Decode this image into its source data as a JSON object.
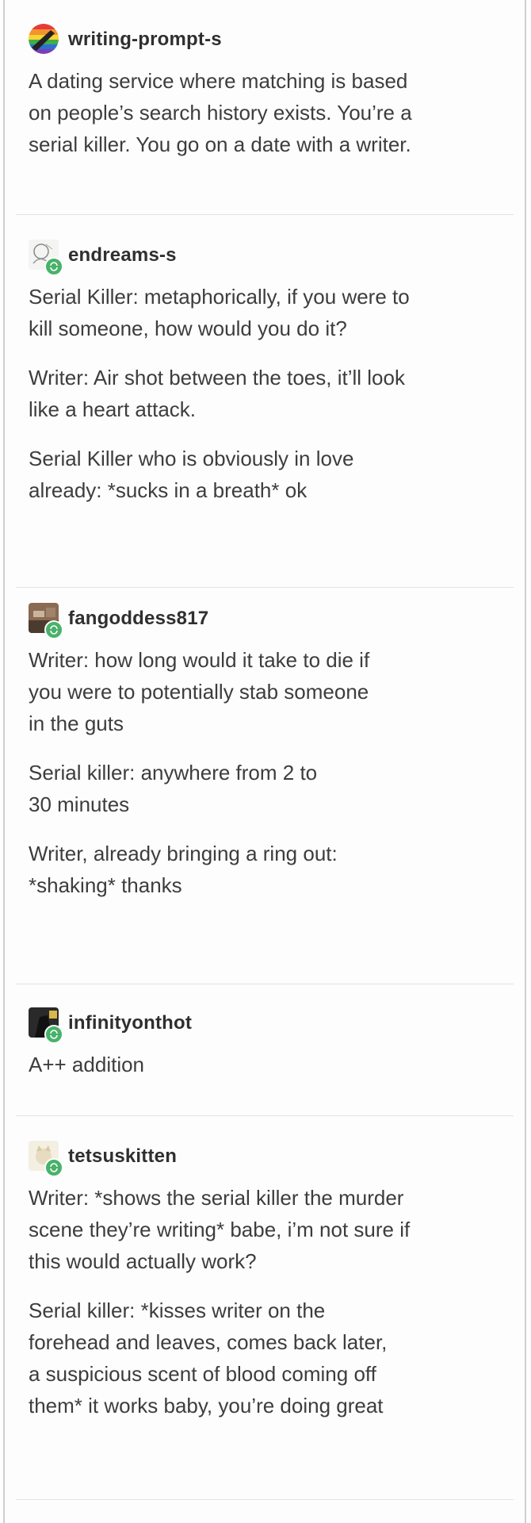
{
  "posts": [
    {
      "username": "writing-prompt-s",
      "avatar_icon": "rainbow-circle-avatar-icon",
      "paragraphs": [
        "A dating service where matching is based\non people’s search history exists. You’re a\nserial killer. You go on a date with a writer."
      ]
    },
    {
      "username": "endreams-s",
      "avatar_icon": "sketch-avatar-icon",
      "paragraphs": [
        "Serial Killer: metaphorically, if you were to\nkill someone, how would you do it?",
        "Writer: Air shot between the toes, it’ll look\nlike a heart attack.",
        "Serial Killer who is obviously in love\nalready: *sucks in a breath* ok"
      ]
    },
    {
      "username": "fangoddess817",
      "avatar_icon": "photo-avatar-icon",
      "paragraphs": [
        "Writer: how long would it take to die if\nyou were to potentially stab someone\nin the guts",
        "Serial killer: anywhere from 2 to\n30 minutes",
        "Writer, already bringing a ring out:\n*shaking* thanks"
      ]
    },
    {
      "username": "infinityonthot",
      "avatar_icon": "dark-photo-avatar-icon",
      "paragraphs": [
        "A++ addition"
      ]
    },
    {
      "username": "tetsuskitten",
      "avatar_icon": "cat-avatar-icon",
      "paragraphs": [
        "Writer: *shows the serial killer the murder\nscene they’re writing* babe, i’m not sure if\nthis would actually work?",
        "Serial killer: *kisses writer on the\nforehead and leaves, comes back later,\na suspicious scent of blood coming off\nthem* it works baby, you’re doing great"
      ]
    }
  ],
  "colors": {
    "reblog_badge": "#48b26a",
    "text": "#3d3d3d",
    "divider": "#e4e4e4"
  }
}
